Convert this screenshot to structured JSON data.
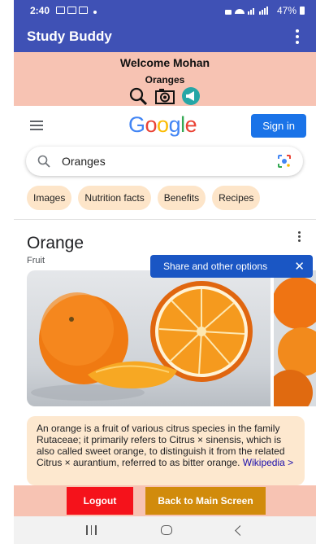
{
  "status_bar": {
    "time": "2:40",
    "battery": "47%"
  },
  "app_bar": {
    "title": "Study Buddy"
  },
  "hero": {
    "welcome": "Welcome  Mohan",
    "topic": "Oranges"
  },
  "google": {
    "logo": "Google",
    "signin_label": "Sign in",
    "search_query": "Oranges",
    "chips": [
      "Images",
      "Nutrition facts",
      "Benefits",
      "Recipes"
    ],
    "knowledge_panel": {
      "title": "Orange",
      "subtitle": "Fruit",
      "tooltip": "Share and other options",
      "description": "An orange is a fruit of various citrus species in the family Rutaceae; it primarily refers to Citrus × sinensis, which is also called sweet orange, to distinguish it from the related Citrus × aurantium, referred to as bitter orange. ",
      "wiki_link": "Wikipedia >"
    }
  },
  "actions": {
    "logout_label": "Logout",
    "back_label": "Back to Main Screen"
  },
  "colors": {
    "primary": "#3f51b5",
    "hero_bg": "#f7c3b3",
    "logout": "#f5121b",
    "back": "#d18b0c",
    "google_blue": "#1a73e8"
  }
}
